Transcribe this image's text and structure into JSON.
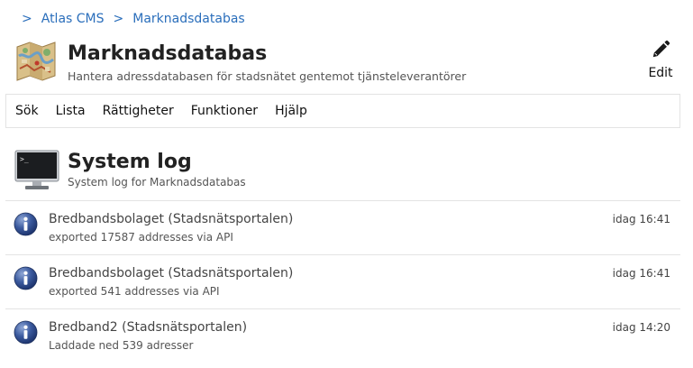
{
  "breadcrumb": {
    "separator": ">",
    "items": [
      "Atlas CMS",
      "Marknadsdatabas"
    ]
  },
  "app": {
    "icon": "map-icon",
    "title": "Marknadsdatabas",
    "subtitle": "Hantera adressdatabasen för stadsnätet gentemot tjänsteleverantörer",
    "edit_label": "Edit",
    "edit_icon": "pencil-icon"
  },
  "menu": {
    "items": [
      "Sök",
      "Lista",
      "Rättigheter",
      "Funktioner",
      "Hjälp"
    ]
  },
  "section": {
    "icon": "terminal-monitor-icon",
    "title": "System log",
    "subtitle": "System log for Marknadsdatabas"
  },
  "log": {
    "entries": [
      {
        "icon": "info-icon",
        "source": "Bredbandsbolaget (Stadsnätsportalen)",
        "message": "exported 17587 addresses via API",
        "time": "idag 16:41"
      },
      {
        "icon": "info-icon",
        "source": "Bredbandsbolaget (Stadsnätsportalen)",
        "message": "exported 541 addresses via API",
        "time": "idag 16:41"
      },
      {
        "icon": "info-icon",
        "source": "Bredband2 (Stadsnätsportalen)",
        "message": "Laddade ned 539 adresser",
        "time": "idag 14:20"
      }
    ]
  },
  "colors": {
    "link": "#2a6ebb",
    "info_icon": "#2f4f8f",
    "border": "#e3e3e3"
  }
}
